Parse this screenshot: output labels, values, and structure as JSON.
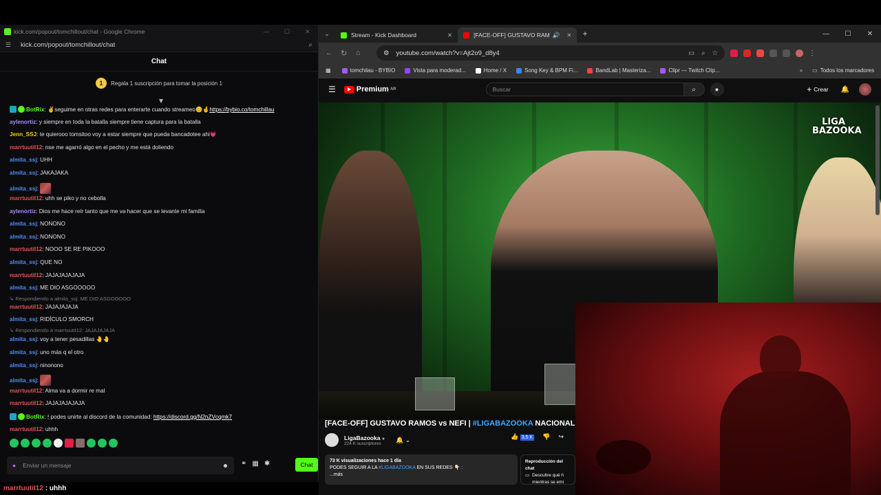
{
  "left_window": {
    "title": "kick.com/popout/tomchillout/chat - Google Chrome",
    "url": "kick.com/popout/tomchillout/chat",
    "chat_header": "Chat",
    "gift_banner": {
      "position": "1",
      "text": "Regala 1 suscripción para tomar la posición 1"
    },
    "messages": [
      {
        "user": "BotRix",
        "color": "#53fc18",
        "text": ": ✌seguime en otras redes para enterarte cuando streameo😊🤞",
        "link": "https://bybio.co/tomchillau",
        "badges": true
      },
      {
        "user": "aylenortiz",
        "color": "#a78bfa",
        "text": ": y siempre en toda la batalla siempre tiene captura para la batalla"
      },
      {
        "user": "Jenn_SSJ",
        "color": "#facc15",
        "text": ": te quierooo tomsitoo voy a estar siempre que pueda bancadotee ahi💗"
      },
      {
        "user": "marrtuutiI12",
        "color": "#e25555",
        "text": ": nse me agarró algo en el pecho y me está doliendo"
      },
      {
        "user": "almita_ssj",
        "color": "#4f8df5",
        "text": ": UHH"
      },
      {
        "user": "almita_ssj",
        "color": "#4f8df5",
        "text": ": JAKAJAKA"
      },
      {
        "user": "almita_ssj",
        "color": "#4f8df5",
        "text": ": ",
        "emote": true
      },
      {
        "user": "marrtuutiI12",
        "color": "#e25555",
        "text": ": uhh se piko y no cebolla"
      },
      {
        "user": "aylenortiz",
        "color": "#a78bfa",
        "text": ": Dios me hace reír tanto que me va hacer que se levante mi familia"
      },
      {
        "user": "almita_ssj",
        "color": "#4f8df5",
        "text": ": NONONO"
      },
      {
        "user": "almita_ssj",
        "color": "#4f8df5",
        "text": ": NONONO"
      },
      {
        "user": "marrtuutiI12",
        "color": "#e25555",
        "text": ": NOOO SE RE PIKOOO"
      },
      {
        "user": "almita_ssj",
        "color": "#4f8df5",
        "text": ": QUE NO"
      },
      {
        "user": "marrtuutiI12",
        "color": "#e25555",
        "text": ": JAJAJAJAJAJA"
      },
      {
        "user": "almita_ssj",
        "color": "#4f8df5",
        "text": ": ME DIO ASGOOOOO"
      },
      {
        "reply": "↳ Respondiendo a almita_ssj: ME DIO ASGOOOOO"
      },
      {
        "user": "marrtuutiI12",
        "color": "#e25555",
        "text": ": JAJAJAJAJA"
      },
      {
        "user": "almita_ssj",
        "color": "#4f8df5",
        "text": ": RIDÍCULO SMORCH"
      },
      {
        "reply": "↳ Respondiendo a marrtuutiI12: JAJAJAJAJA"
      },
      {
        "user": "almita_ssj",
        "color": "#4f8df5",
        "text": ": voy a tener pesadillas 🤚🤚"
      },
      {
        "user": "almita_ssj",
        "color": "#4f8df5",
        "text": ": uno más q el otro"
      },
      {
        "user": "almita_ssj",
        "color": "#4f8df5",
        "text": ": ninonono"
      },
      {
        "user": "almita_ssj",
        "color": "#4f8df5",
        "text": ": ",
        "emote": true
      },
      {
        "user": "marrtuutiI12",
        "color": "#e25555",
        "text": ": Alma va a dormir re mal"
      },
      {
        "user": "marrtuutiI12",
        "color": "#e25555",
        "text": ": JAJAJAJAJAJA"
      },
      {
        "user": "BotRix",
        "color": "#53fc18",
        "text": ": 🕯 podes unirte al discord de la comunidad: ",
        "link": "https://discord.gg/N2nZVcqmk7",
        "badges": true
      },
      {
        "user": "marrtuutiI12",
        "color": "#e25555",
        "text": ": uhhh"
      }
    ],
    "input_placeholder": "Enviar un mensaje",
    "send_label": "Chat",
    "bottom_caption": {
      "user": "marrtuutiI12",
      "text": ": uhhh"
    }
  },
  "right_window": {
    "tabs": [
      {
        "label": "Stream - Kick Dashboard",
        "icon_color": "#53fc18"
      },
      {
        "label": "[FACE-OFF] GUSTAVO RAM",
        "icon_color": "#ff0000"
      }
    ],
    "url": "youtube.com/watch?v=Ajt2o9_d8y4",
    "bookmarks": [
      {
        "label": "tomchilau - BYBIO",
        "color": "#a855f7"
      },
      {
        "label": "Vista para moderad...",
        "color": "#9146ff"
      },
      {
        "label": "Home / X",
        "color": "#ffffff"
      },
      {
        "label": "Song Key & BPM Fi...",
        "color": "#3b82f6"
      },
      {
        "label": "BandLab | Masteriza...",
        "color": "#ef4444"
      },
      {
        "label": "Clipr — Twitch Clip...",
        "color": "#a855f7"
      }
    ],
    "all_bookmarks": "Todos los marcadores",
    "yt": {
      "logo": "Premium",
      "logo_country": "AR",
      "search_placeholder": "Buscar",
      "create": "Crear",
      "league_logo": "LIGA BAZOOKA",
      "video_title_a": "[FACE-OFF] GUSTAVO RAMOS vs NEFI | ",
      "video_title_tag": "#LIGABAZOOKA",
      "video_title_b": " NACIONAL ARGENT",
      "channel": "LigaBazooka",
      "subs": "224 K suscriptores",
      "likes": "3,5 K",
      "desc_stats": "73 K visualizaciones  hace 1 día",
      "desc_line_a": "PODES SEGUIR A LA ",
      "desc_tag": "#LIGABAZOOKA",
      "desc_line_b": " EN SUS REDES 👇🏻 :",
      "desc_more": "...más",
      "chat_replay_title": "Reproducción del chat",
      "chat_replay_text": "Descubre qué h mientras se emi"
    }
  }
}
